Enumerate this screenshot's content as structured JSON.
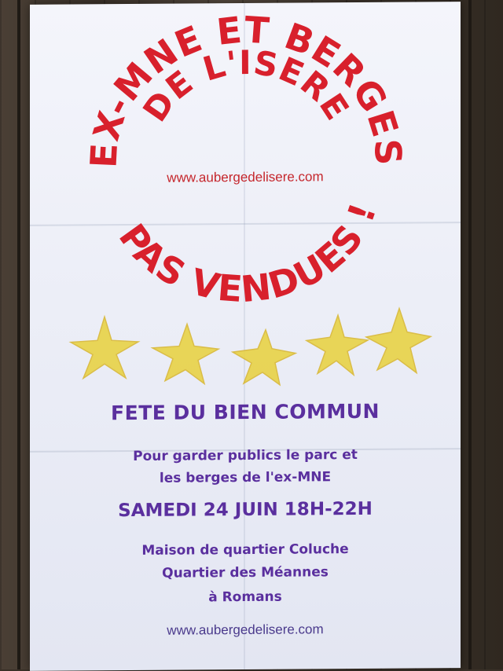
{
  "poster": {
    "headline_top_line1": "EX-MNE ET BERGES",
    "headline_top_line2": "DE L'ISERE",
    "website_top": "www.aubergedelisere.com",
    "headline_bottom": "PAS VENDUES !",
    "event_title": "FETE DU BIEN COMMUN",
    "purpose_line1": "Pour garder publics le parc et",
    "purpose_line2": "les berges de l'ex-MNE",
    "date_time": "SAMEDI 24 JUIN  18H-22H",
    "location_line1": "Maison de quartier Coluche",
    "location_line2": "Quartier des Méannes",
    "location_line3": "à Romans",
    "website_bottom": "www.aubergedelisere.com"
  },
  "colors": {
    "headline_red": "#d8202c",
    "text_purple": "#5a2f9e",
    "star_yellow": "#e8d34a"
  },
  "decor": {
    "star_count": 5,
    "background": "wooden planks"
  }
}
